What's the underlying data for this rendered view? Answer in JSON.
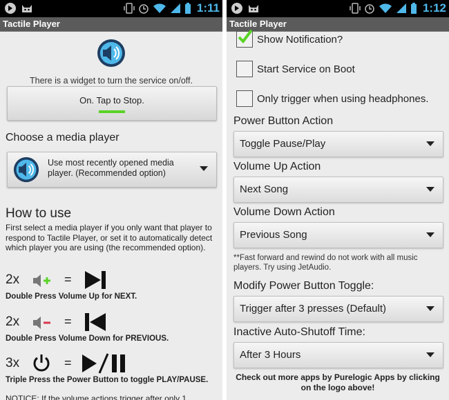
{
  "status_bar_left": {
    "time": "1:11"
  },
  "status_bar_right": {
    "time": "1:12"
  },
  "app_title": "Tactile Player",
  "left": {
    "app_icon": "speaker-play-icon",
    "widget_hint": "There is a widget to turn the service on/off.",
    "toggle_button_label": "On. Tap to Stop.",
    "toggle_state_color": "#5ad327",
    "choose_player_heading": "Choose a media player",
    "media_player_spinner": "Use most recently opened media player. (Recommended option)",
    "how_to_use_heading": "How to use",
    "how_to_use_text": "First select a media player if you only want that player to respond to Tactile Player, or set it to automatically detect which player you are using (the recommended option).",
    "gestures": [
      {
        "count": "2x",
        "icon": "volume-up-icon",
        "result_icon": "next-track-icon",
        "caption": "Double Press Volume Up for NEXT."
      },
      {
        "count": "2x",
        "icon": "volume-down-icon",
        "result_icon": "previous-track-icon",
        "caption": "Double Press Volume Down for PREVIOUS."
      },
      {
        "count": "3x",
        "icon": "power-icon",
        "result_icon": "play-pause-icon",
        "caption": "Triple Press the Power Button to toggle PLAY/PAUSE."
      }
    ],
    "equals": "=",
    "notice_partial": "NOTICE: If the volume actions trigger after only 1"
  },
  "right": {
    "checkboxes": [
      {
        "label": "Show Notification?",
        "checked": true
      },
      {
        "label": "Start Service on Boot",
        "checked": false
      },
      {
        "label": "Only trigger when using headphones.",
        "checked": false
      }
    ],
    "power_action_label": "Power Button Action",
    "power_action_value": "Toggle Pause/Play",
    "volume_up_label": "Volume Up Action",
    "volume_up_value": "Next Song",
    "volume_down_label": "Volume Down Action",
    "volume_down_value": "Previous Song",
    "ff_note": "**Fast forward and rewind do not work with all music players. Try using JetAudio.",
    "modify_toggle_label": "Modify Power Button Toggle:",
    "modify_toggle_value": "Trigger after 3 presses (Default)",
    "shutoff_label": "Inactive Auto-Shutoff Time:",
    "shutoff_value": "After 3 Hours",
    "footer_text": "Check out more apps by Purelogic Apps by clicking on the logo above!"
  },
  "colors": {
    "accent_blue": "#4fb8ea",
    "check_green": "#5ad327",
    "action_bar": "#5b5b5b"
  }
}
